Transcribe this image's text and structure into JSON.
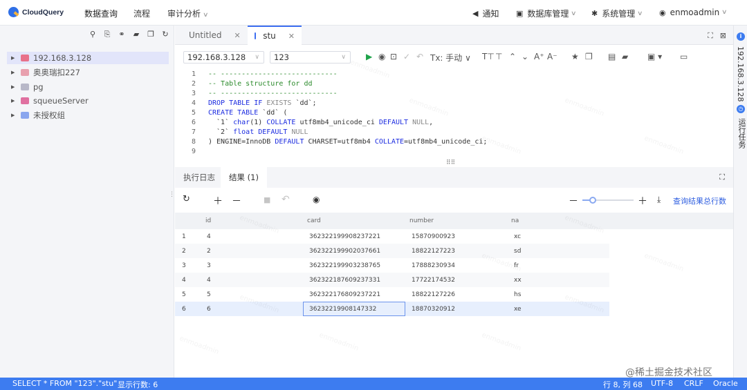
{
  "app": {
    "brand": "CloudQuery",
    "nav": [
      "数据查询",
      "流程",
      "审计分析"
    ],
    "right_nav": {
      "notify": "通知",
      "dbmanage": "数据库管理",
      "sysmanage": "系统管理",
      "user": "enmoadmin"
    }
  },
  "sidebar": {
    "items": [
      {
        "label": "192.168.3.128",
        "color": "#e8718a"
      },
      {
        "label": "奥奥瑞扣227",
        "color": "#e8a0ae"
      },
      {
        "label": "pg",
        "color": "#b8b8c8"
      },
      {
        "label": "squeueServer",
        "color": "#e070a0"
      },
      {
        "label": "未授权组",
        "color": "#8aa6ee"
      }
    ]
  },
  "tabs": [
    {
      "label": "Untitled",
      "close": "✕"
    },
    {
      "label": "stu",
      "close": "✕"
    }
  ],
  "toolbar": {
    "connection": "192.168.3.128",
    "database": "123",
    "tx_label": "Tx: 手动"
  },
  "editor": {
    "lines": [
      "1",
      "2",
      "3",
      "4",
      "5",
      "6",
      "7",
      "8",
      "9"
    ]
  },
  "results": {
    "tab_log": "执行日志",
    "tab_result": "结果 (1)",
    "total_link": "查询结果总行数",
    "columns": [
      "id",
      "card",
      "number",
      "na"
    ],
    "rows": [
      {
        "n": "1",
        "id": "4",
        "card": "362322199908237221",
        "number": "15870900923",
        "na": "xc"
      },
      {
        "n": "2",
        "id": "2",
        "card": "362322199902037661",
        "number": "18822127223",
        "na": "sd"
      },
      {
        "n": "3",
        "id": "3",
        "card": "362322199903238765",
        "number": "17888230934",
        "na": "fr"
      },
      {
        "n": "4",
        "id": "4",
        "card": "362322187609237331",
        "number": "17722174532",
        "na": "xx"
      },
      {
        "n": "5",
        "id": "5",
        "card": "362322176809237221",
        "number": "18822127226",
        "na": "hs"
      },
      {
        "n": "6",
        "id": "6",
        "card": "36232219908147332",
        "number": "18870320912",
        "na": "xe"
      }
    ]
  },
  "rail": {
    "label1": "192.168.3.128",
    "label2": "运行任务"
  },
  "status": {
    "query": "SELECT * FROM \"123\".\"stu\"",
    "rows": "显示行数: 6",
    "position": "行 8, 列 68",
    "encoding": "UTF-8",
    "eol": "CRLF",
    "db": "Oracle"
  },
  "watermark": "enmoadmin",
  "juejin": "@稀土掘金技术社区"
}
